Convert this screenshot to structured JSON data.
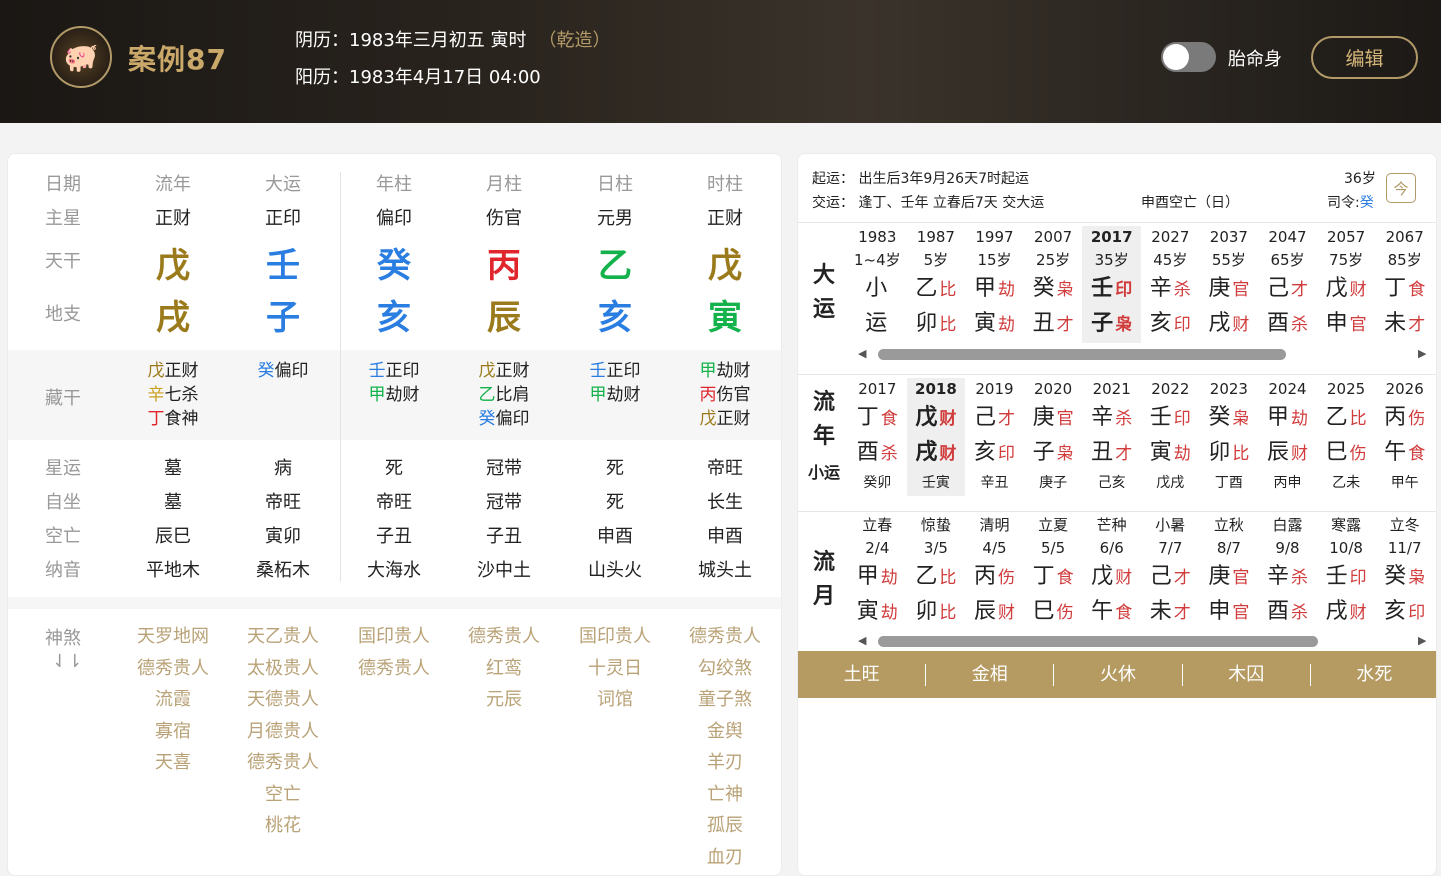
{
  "header": {
    "avatar_icon": "pig-zodiac-icon",
    "title": "案例87",
    "lunar": "阴历：1983年三月初五 寅时",
    "gender": "（乾造）",
    "solar": "阳历：1983年4月17日 04:00",
    "toggle_label": "胎命身",
    "edit_label": "编辑"
  },
  "colors": {
    "wood": "#13b24a",
    "fire": "#e0262c",
    "earth": "#9a7a1a",
    "metal": "#c9a020",
    "water": "#2a7de1",
    "accent": "#b59a61"
  },
  "chart": {
    "row_labels": {
      "date": "日期",
      "main_star": "主星",
      "stem": "天干",
      "branch": "地支",
      "hidden": "藏干",
      "xingyun": "星运",
      "zizuo": "自坐",
      "kongwang": "空亡",
      "nayin": "纳音",
      "shensha": "神煞",
      "expand": "⇃⇂"
    },
    "columns": [
      {
        "header": "流年",
        "main_star": "正财",
        "stem": "戊",
        "stem_color": "#9a7a1a",
        "branch": "戌",
        "branch_color": "#9a7a1a",
        "hidden": [
          {
            "g": "戊",
            "gc": "#9a7a1a",
            "s": "正财"
          },
          {
            "g": "辛",
            "gc": "#c9a020",
            "s": "七杀"
          },
          {
            "g": "丁",
            "gc": "#e0262c",
            "s": "食神"
          }
        ],
        "xingyun": "墓",
        "zizuo": "墓",
        "kongwang": "辰巳",
        "nayin": "平地木",
        "shensha": [
          "天罗地网",
          "德秀贵人",
          "流霞",
          "寡宿",
          "天喜"
        ]
      },
      {
        "header": "大运",
        "main_star": "正印",
        "stem": "壬",
        "stem_color": "#2a7de1",
        "branch": "子",
        "branch_color": "#2a7de1",
        "hidden": [
          {
            "g": "癸",
            "gc": "#2a7de1",
            "s": "偏印"
          }
        ],
        "xingyun": "病",
        "zizuo": "帝旺",
        "kongwang": "寅卯",
        "nayin": "桑柘木",
        "shensha": [
          "天乙贵人",
          "太极贵人",
          "天德贵人",
          "月德贵人",
          "德秀贵人",
          "空亡",
          "桃花"
        ]
      },
      {
        "header": "年柱",
        "main_star": "偏印",
        "stem": "癸",
        "stem_color": "#2a7de1",
        "branch": "亥",
        "branch_color": "#2a7de1",
        "hidden": [
          {
            "g": "壬",
            "gc": "#2a7de1",
            "s": "正印"
          },
          {
            "g": "甲",
            "gc": "#13b24a",
            "s": "劫财"
          }
        ],
        "xingyun": "死",
        "zizuo": "帝旺",
        "kongwang": "子丑",
        "nayin": "大海水",
        "shensha": [
          "国印贵人",
          "德秀贵人"
        ]
      },
      {
        "header": "月柱",
        "main_star": "伤官",
        "stem": "丙",
        "stem_color": "#e0262c",
        "branch": "辰",
        "branch_color": "#9a7a1a",
        "hidden": [
          {
            "g": "戊",
            "gc": "#9a7a1a",
            "s": "正财"
          },
          {
            "g": "乙",
            "gc": "#13b24a",
            "s": "比肩"
          },
          {
            "g": "癸",
            "gc": "#2a7de1",
            "s": "偏印"
          }
        ],
        "xingyun": "冠带",
        "zizuo": "冠带",
        "kongwang": "子丑",
        "nayin": "沙中土",
        "shensha": [
          "德秀贵人",
          "红鸾",
          "元辰"
        ]
      },
      {
        "header": "日柱",
        "main_star": "元男",
        "stem": "乙",
        "stem_color": "#13b24a",
        "branch": "亥",
        "branch_color": "#2a7de1",
        "hidden": [
          {
            "g": "壬",
            "gc": "#2a7de1",
            "s": "正印"
          },
          {
            "g": "甲",
            "gc": "#13b24a",
            "s": "劫财"
          }
        ],
        "xingyun": "死",
        "zizuo": "死",
        "kongwang": "申酉",
        "nayin": "山头火",
        "shensha": [
          "国印贵人",
          "十灵日",
          "词馆"
        ]
      },
      {
        "header": "时柱",
        "main_star": "正财",
        "stem": "戊",
        "stem_color": "#9a7a1a",
        "branch": "寅",
        "branch_color": "#13b24a",
        "hidden": [
          {
            "g": "甲",
            "gc": "#13b24a",
            "s": "劫财"
          },
          {
            "g": "丙",
            "gc": "#e0262c",
            "s": "伤官"
          },
          {
            "g": "戊",
            "gc": "#9a7a1a",
            "s": "正财"
          }
        ],
        "xingyun": "帝旺",
        "zizuo": "长生",
        "kongwang": "申酉",
        "nayin": "城头土",
        "shensha": [
          "德秀贵人",
          "勾绞煞",
          "童子煞",
          "金舆",
          "羊刃",
          "亡神",
          "孤辰",
          "血刃"
        ]
      }
    ]
  },
  "luck": {
    "qiyun": "起运：  出生后3年9月26天7时起运",
    "jiaoyun": "交运：  逢丁、壬年 立春后7天 交大运",
    "kongwang": "申酉空亡（日）",
    "age": "36岁",
    "siling_label": "司令:",
    "siling_value": "癸",
    "calendar_icon": "今",
    "dayun_title": [
      "大",
      "运"
    ],
    "dayun": [
      {
        "y": "1983",
        "a": "1~4岁",
        "g1": "小",
        "t1": "",
        "g2": "运",
        "t2": ""
      },
      {
        "y": "1987",
        "a": "5岁",
        "g1": "乙",
        "t1": "比",
        "g2": "卯",
        "t2": "比"
      },
      {
        "y": "1997",
        "a": "15岁",
        "g1": "甲",
        "t1": "劫",
        "g2": "寅",
        "t2": "劫"
      },
      {
        "y": "2007",
        "a": "25岁",
        "g1": "癸",
        "t1": "枭",
        "g2": "丑",
        "t2": "才"
      },
      {
        "y": "2017",
        "a": "35岁",
        "g1": "壬",
        "t1": "印",
        "g2": "子",
        "t2": "枭",
        "sel": true
      },
      {
        "y": "2027",
        "a": "45岁",
        "g1": "辛",
        "t1": "杀",
        "g2": "亥",
        "t2": "印"
      },
      {
        "y": "2037",
        "a": "55岁",
        "g1": "庚",
        "t1": "官",
        "g2": "戌",
        "t2": "财"
      },
      {
        "y": "2047",
        "a": "65岁",
        "g1": "己",
        "t1": "才",
        "g2": "酉",
        "t2": "杀"
      },
      {
        "y": "2057",
        "a": "75岁",
        "g1": "戊",
        "t1": "财",
        "g2": "申",
        "t2": "官"
      },
      {
        "y": "2067",
        "a": "85岁",
        "g1": "丁",
        "t1": "食",
        "g2": "未",
        "t2": "才"
      }
    ],
    "liunian_title": [
      "流",
      "年"
    ],
    "xiaoyun_label": "小运",
    "liunian": [
      {
        "y": "2017",
        "g1": "丁",
        "t1": "食",
        "g2": "酉",
        "t2": "杀",
        "x": "癸卯"
      },
      {
        "y": "2018",
        "g1": "戊",
        "t1": "财",
        "g2": "戌",
        "t2": "财",
        "x": "壬寅",
        "sel": true
      },
      {
        "y": "2019",
        "g1": "己",
        "t1": "才",
        "g2": "亥",
        "t2": "印",
        "x": "辛丑"
      },
      {
        "y": "2020",
        "g1": "庚",
        "t1": "官",
        "g2": "子",
        "t2": "枭",
        "x": "庚子"
      },
      {
        "y": "2021",
        "g1": "辛",
        "t1": "杀",
        "g2": "丑",
        "t2": "才",
        "x": "己亥"
      },
      {
        "y": "2022",
        "g1": "壬",
        "t1": "印",
        "g2": "寅",
        "t2": "劫",
        "x": "戊戌"
      },
      {
        "y": "2023",
        "g1": "癸",
        "t1": "枭",
        "g2": "卯",
        "t2": "比",
        "x": "丁酉"
      },
      {
        "y": "2024",
        "g1": "甲",
        "t1": "劫",
        "g2": "辰",
        "t2": "财",
        "x": "丙申"
      },
      {
        "y": "2025",
        "g1": "乙",
        "t1": "比",
        "g2": "巳",
        "t2": "伤",
        "x": "乙未"
      },
      {
        "y": "2026",
        "g1": "丙",
        "t1": "伤",
        "g2": "午",
        "t2": "食",
        "x": "甲午"
      }
    ],
    "liuyue_title": [
      "流",
      "月"
    ],
    "liuyue": [
      {
        "y": "立春",
        "a": "2/4",
        "g1": "甲",
        "t1": "劫",
        "g2": "寅",
        "t2": "劫"
      },
      {
        "y": "惊蛰",
        "a": "3/5",
        "g1": "乙",
        "t1": "比",
        "g2": "卯",
        "t2": "比"
      },
      {
        "y": "清明",
        "a": "4/5",
        "g1": "丙",
        "t1": "伤",
        "g2": "辰",
        "t2": "财"
      },
      {
        "y": "立夏",
        "a": "5/5",
        "g1": "丁",
        "t1": "食",
        "g2": "巳",
        "t2": "伤"
      },
      {
        "y": "芒种",
        "a": "6/6",
        "g1": "戊",
        "t1": "财",
        "g2": "午",
        "t2": "食"
      },
      {
        "y": "小暑",
        "a": "7/7",
        "g1": "己",
        "t1": "才",
        "g2": "未",
        "t2": "才"
      },
      {
        "y": "立秋",
        "a": "8/7",
        "g1": "庚",
        "t1": "官",
        "g2": "申",
        "t2": "官"
      },
      {
        "y": "白露",
        "a": "9/8",
        "g1": "辛",
        "t1": "杀",
        "g2": "酉",
        "t2": "杀"
      },
      {
        "y": "寒露",
        "a": "10/8",
        "g1": "壬",
        "t1": "印",
        "g2": "戌",
        "t2": "财"
      },
      {
        "y": "立冬",
        "a": "11/7",
        "g1": "癸",
        "t1": "枭",
        "g2": "亥",
        "t2": "印"
      }
    ],
    "seasons": [
      "土旺",
      "金相",
      "火休",
      "木囚",
      "水死"
    ]
  }
}
